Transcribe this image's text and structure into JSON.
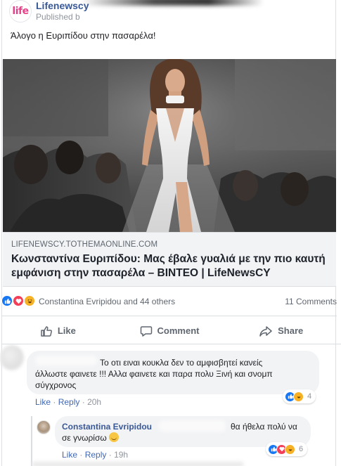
{
  "post": {
    "page_name": "Lifenewscy",
    "logo_text": "life",
    "published_label": "Published b",
    "text": "Άλογο η Ευριπίδου στην πασαρέλα!"
  },
  "link": {
    "domain": "LIFENEWSCY.TOTHEMAONLINE.COM",
    "title": "Κωνσταντίνα Ευριπίδου: Μας έβαλε γυαλιά με την πιο καυτή εμφάνιση στην πασαρέλα – ΒΙΝΤΕΟ | LifeNewsCY"
  },
  "reactions": {
    "types": [
      "like",
      "love",
      "haha"
    ],
    "reactors_text": "Constantina Evripidou and 44 others",
    "comments_count": "11 Comments"
  },
  "actions": {
    "like": "Like",
    "comment": "Comment",
    "share": "Share"
  },
  "comments": [
    {
      "text_lead": "Το οτι ειναι κουκλα δεν το αμφισβητεί κανείς",
      "text_rest": "άλλωστε φαινετε !!! Αλλα φαινετε και παρα πολυ Ξινή και σνομπ σύγχρονος",
      "like_label": "Like",
      "reply_label": "Reply",
      "time": "20h",
      "reaction_count": "4"
    },
    {
      "author": "Constantina Evripidou",
      "text_lead": "θα ήθελα πολύ να",
      "text_rest": "σε γνωρίσω",
      "like_label": "Like",
      "reply_label": "Reply",
      "time": "19h",
      "reaction_count": "6"
    }
  ],
  "colors": {
    "link_blue": "#385898",
    "like_blue": "#1877f2",
    "love_red": "#f33e58",
    "haha_yellow": "#f7b125",
    "muted_text": "#606770"
  }
}
